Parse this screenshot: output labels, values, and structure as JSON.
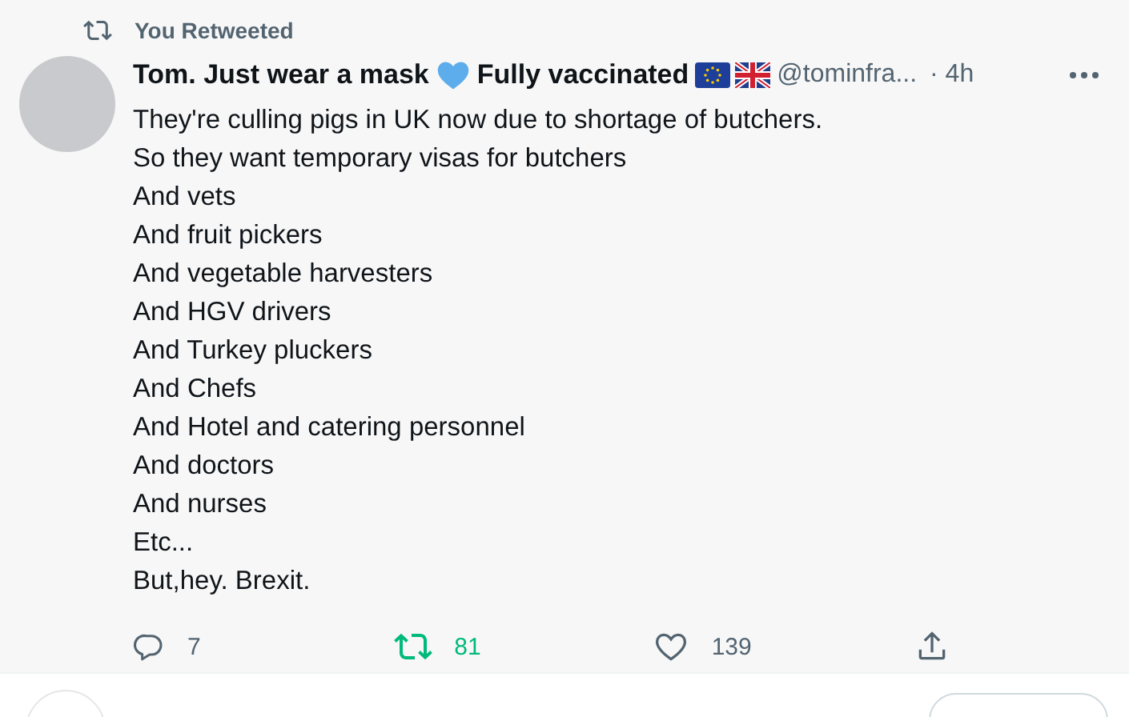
{
  "social_context": "You Retweeted",
  "tweet": {
    "name_before_heart": "Tom. Just wear a mask",
    "name_after_heart": "Fully vaccinated",
    "handle": "@tominfra...",
    "time": "· 4h",
    "lines": [
      "They're culling pigs in UK now due to shortage of butchers.",
      "So they want temporary visas for butchers",
      "And vets",
      "And fruit pickers",
      "And vegetable harvesters",
      "And HGV drivers",
      "And Turkey pluckers",
      "And Chefs",
      "And Hotel and catering personnel",
      "And doctors",
      "And nurses",
      "Etc...",
      "But,hey. Brexit."
    ],
    "actions": {
      "replies": "7",
      "retweets": "81",
      "retweeted": true,
      "likes": "139",
      "liked": false
    }
  }
}
